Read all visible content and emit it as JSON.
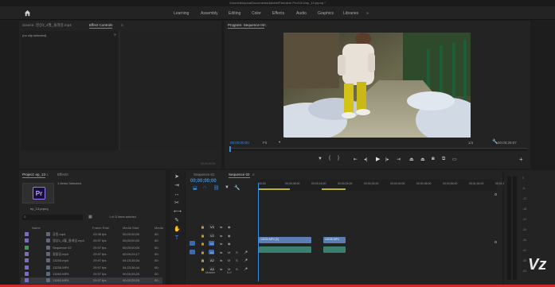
{
  "window": {
    "title": "/Users/leeyuna/Documents/Adobe/Premiere Pro/15.0/ep_13.prproj *"
  },
  "menu": {
    "workspaces": [
      "Learning",
      "Assembly",
      "Editing",
      "Color",
      "Effects",
      "Audio",
      "Graphics",
      "Libraries"
    ],
    "overflow": "»"
  },
  "source_panel": {
    "tab_source": "Source: 영상3_4월_둘레길.mp4",
    "tab_effects": "Effect Controls",
    "menu_glyph": "≡",
    "no_clip": "(no clip selected)",
    "more": "»",
    "bottom_timecode": "00;00;00;00"
  },
  "program": {
    "tab": "Program: Sequence 02",
    "menu_glyph": "≡",
    "timecode": "00;00;00;00",
    "fit": "Fit",
    "quality": "1/4",
    "duration": "00;00;29;07"
  },
  "project": {
    "tab": "Project: ep_13",
    "tab_effects": "Effects",
    "items_selected": "1 of 11 items selected",
    "bin_label": "1 Items Selected",
    "project_file": "ep_13.prproj",
    "app_logo": "Pr",
    "search_placeholder": "",
    "columns": {
      "name": "Name",
      "frame_rate": "Frame Rate",
      "media_start": "Media Start",
      "media": "Media"
    },
    "rows": [
      {
        "name": "공원.mp4",
        "frame_rate": "23.98 fps",
        "media_start": "00;00;00;00",
        "media": "00:",
        "color": "#7b6bc6"
      },
      {
        "name": "영상3_4월_둘레길.mp4",
        "frame_rate": "29.97 fps",
        "media_start": "00;00;00;00",
        "media": "00:",
        "color": "#7b6bc6"
      },
      {
        "name": "Sequence 02",
        "frame_rate": "29.97 fps",
        "media_start": "00;00;00;00",
        "media": "00:",
        "color": "#3b9a53"
      },
      {
        "name": "꽃밭길.mp4",
        "frame_rate": "29.97 fps",
        "media_start": "00;04;24;17",
        "media": "00:",
        "color": "#7b6bc6"
      },
      {
        "name": "13234.mp4",
        "frame_rate": "29.97 fps",
        "media_start": "04;23;35;34",
        "media": "00:",
        "color": "#7b6bc6"
      },
      {
        "name": "13236.MP4",
        "frame_rate": "29.97 fps",
        "media_start": "04;23;36;44",
        "media": "00:",
        "color": "#7b6bc6"
      },
      {
        "name": "13262.MP4",
        "frame_rate": "29.97 fps",
        "media_start": "00;00;25;20",
        "media": "00:",
        "color": "#7b6bc6"
      },
      {
        "name": "13263.MP4",
        "frame_rate": "29.97 fps",
        "media_start": "00;00;25;20",
        "media": "00:",
        "color": "#7b6bc6"
      }
    ]
  },
  "timeline": {
    "tab_seq1": "Sequence 01",
    "tab_seq2": "Sequence 02",
    "menu_glyph": "≡",
    "timecode": "00;00;00;00",
    "ruler": [
      "00;00",
      "00;00;08;00",
      "00;00;16;00",
      "00;00;24;00",
      "00;00;32;00",
      "00;00;40;00",
      "00;00;48;00",
      "00;00;56;00",
      "00;01;04;02",
      "00;01;12;02"
    ],
    "tracks": [
      {
        "label": "V3"
      },
      {
        "label": "V2"
      },
      {
        "label": "V1"
      },
      {
        "label": "A1"
      },
      {
        "label": "A2"
      },
      {
        "label": "A3"
      }
    ],
    "master": "Master",
    "master_value": "0.0",
    "clips": [
      {
        "label": "13234.MP4 [V]"
      },
      {
        "label": "13236.MP4"
      }
    ]
  },
  "audio_meter": {
    "scale": [
      "0",
      "-6",
      "-12",
      "-18",
      "-24",
      "-30",
      "-36",
      "-42",
      "-48",
      "-54"
    ]
  },
  "watermark": "Vz"
}
